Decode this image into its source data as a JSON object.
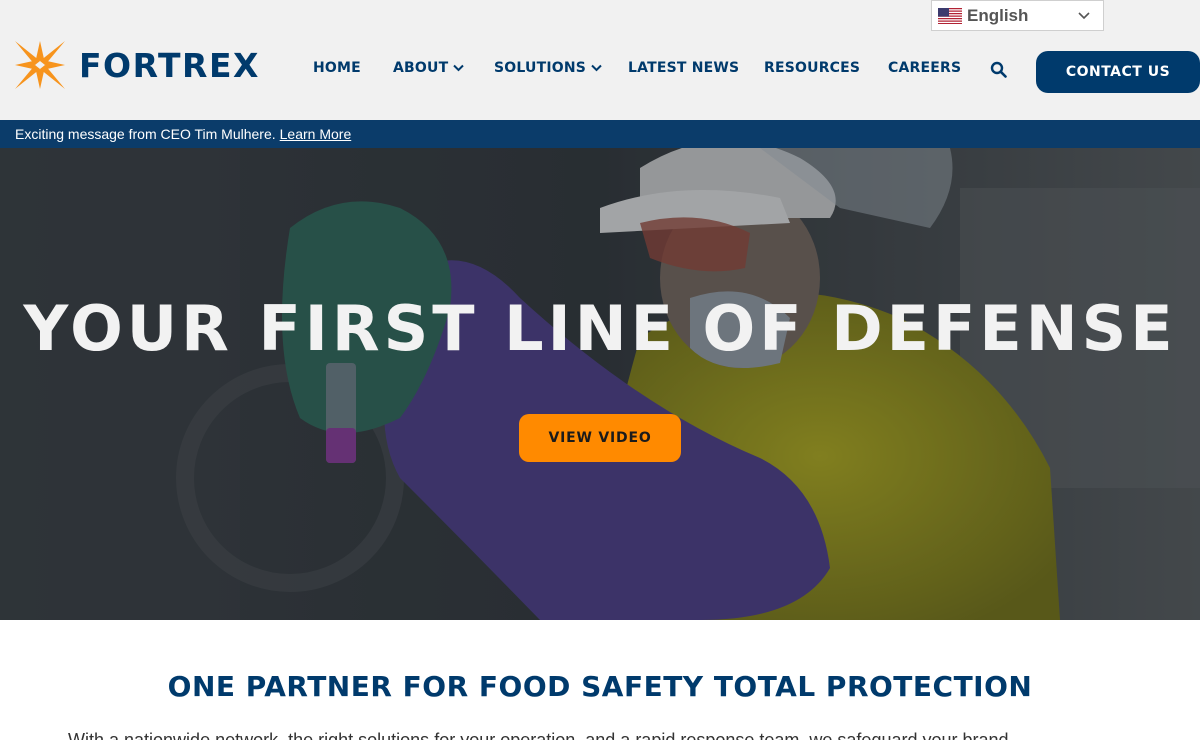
{
  "header": {
    "logo_text": "FORTREX",
    "language": {
      "selected": "English",
      "flag_icon": "us-flag-icon"
    },
    "nav": [
      {
        "label": "HOME",
        "has_dropdown": false
      },
      {
        "label": "ABOUT",
        "has_dropdown": true
      },
      {
        "label": "SOLUTIONS",
        "has_dropdown": true
      },
      {
        "label": "LATEST NEWS",
        "has_dropdown": false
      },
      {
        "label": "RESOURCES",
        "has_dropdown": false
      },
      {
        "label": "CAREERS",
        "has_dropdown": false
      }
    ],
    "contact_label": "CONTACT US"
  },
  "announcement": {
    "message": "Exciting message from CEO Tim Mulhere.",
    "link_label": "Learn More"
  },
  "hero": {
    "title": "YOUR FIRST LINE OF DEFENSE",
    "button_label": "VIEW VIDEO"
  },
  "partner": {
    "title": "ONE PARTNER FOR FOOD SAFETY TOTAL PROTECTION",
    "text": "With a nationwide network, the right solutions for your operation, and a rapid response team, we safeguard your brand"
  },
  "colors": {
    "brand_navy": "#003a6c",
    "accent_orange": "#ff8a00",
    "header_bg": "#f1f1f1",
    "announce_bg": "#0b3c6a"
  }
}
